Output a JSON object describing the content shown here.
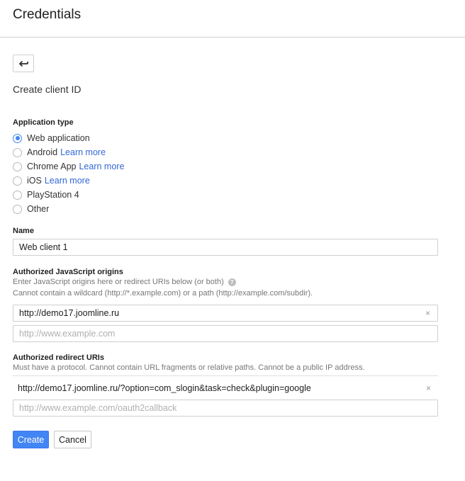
{
  "header": {
    "title": "Credentials"
  },
  "page": {
    "section_title": "Create client ID"
  },
  "application_type": {
    "label": "Application type",
    "options": [
      {
        "label": "Web application",
        "link": "",
        "checked": true
      },
      {
        "label": "Android",
        "link": "Learn more",
        "checked": false
      },
      {
        "label": "Chrome App",
        "link": "Learn more",
        "checked": false
      },
      {
        "label": "iOS",
        "link": "Learn more",
        "checked": false
      },
      {
        "label": "PlayStation 4",
        "link": "",
        "checked": false
      },
      {
        "label": "Other",
        "link": "",
        "checked": false
      }
    ]
  },
  "name_field": {
    "label": "Name",
    "value": "Web client 1"
  },
  "js_origins": {
    "label": "Authorized JavaScript origins",
    "help_line1": "Enter JavaScript origins here or redirect URIs below (or both)",
    "help_icon": "?",
    "help_line2": "Cannot contain a wildcard (http://*.example.com) or a path (http://example.com/subdir).",
    "value": "http://demo17.joomline.ru",
    "placeholder": "http://www.example.com"
  },
  "redirect_uris": {
    "label": "Authorized redirect URIs",
    "help": "Must have a protocol. Cannot contain URL fragments or relative paths. Cannot be a public IP address.",
    "value": "http://demo17.joomline.ru/?option=com_slogin&task=check&plugin=google",
    "placeholder": "http://www.example.com/oauth2callback"
  },
  "icons": {
    "clear": "×",
    "back": "back-arrow-icon"
  },
  "buttons": {
    "create": "Create",
    "cancel": "Cancel"
  },
  "colors": {
    "accent": "#4285f4",
    "link": "#3367d6"
  }
}
